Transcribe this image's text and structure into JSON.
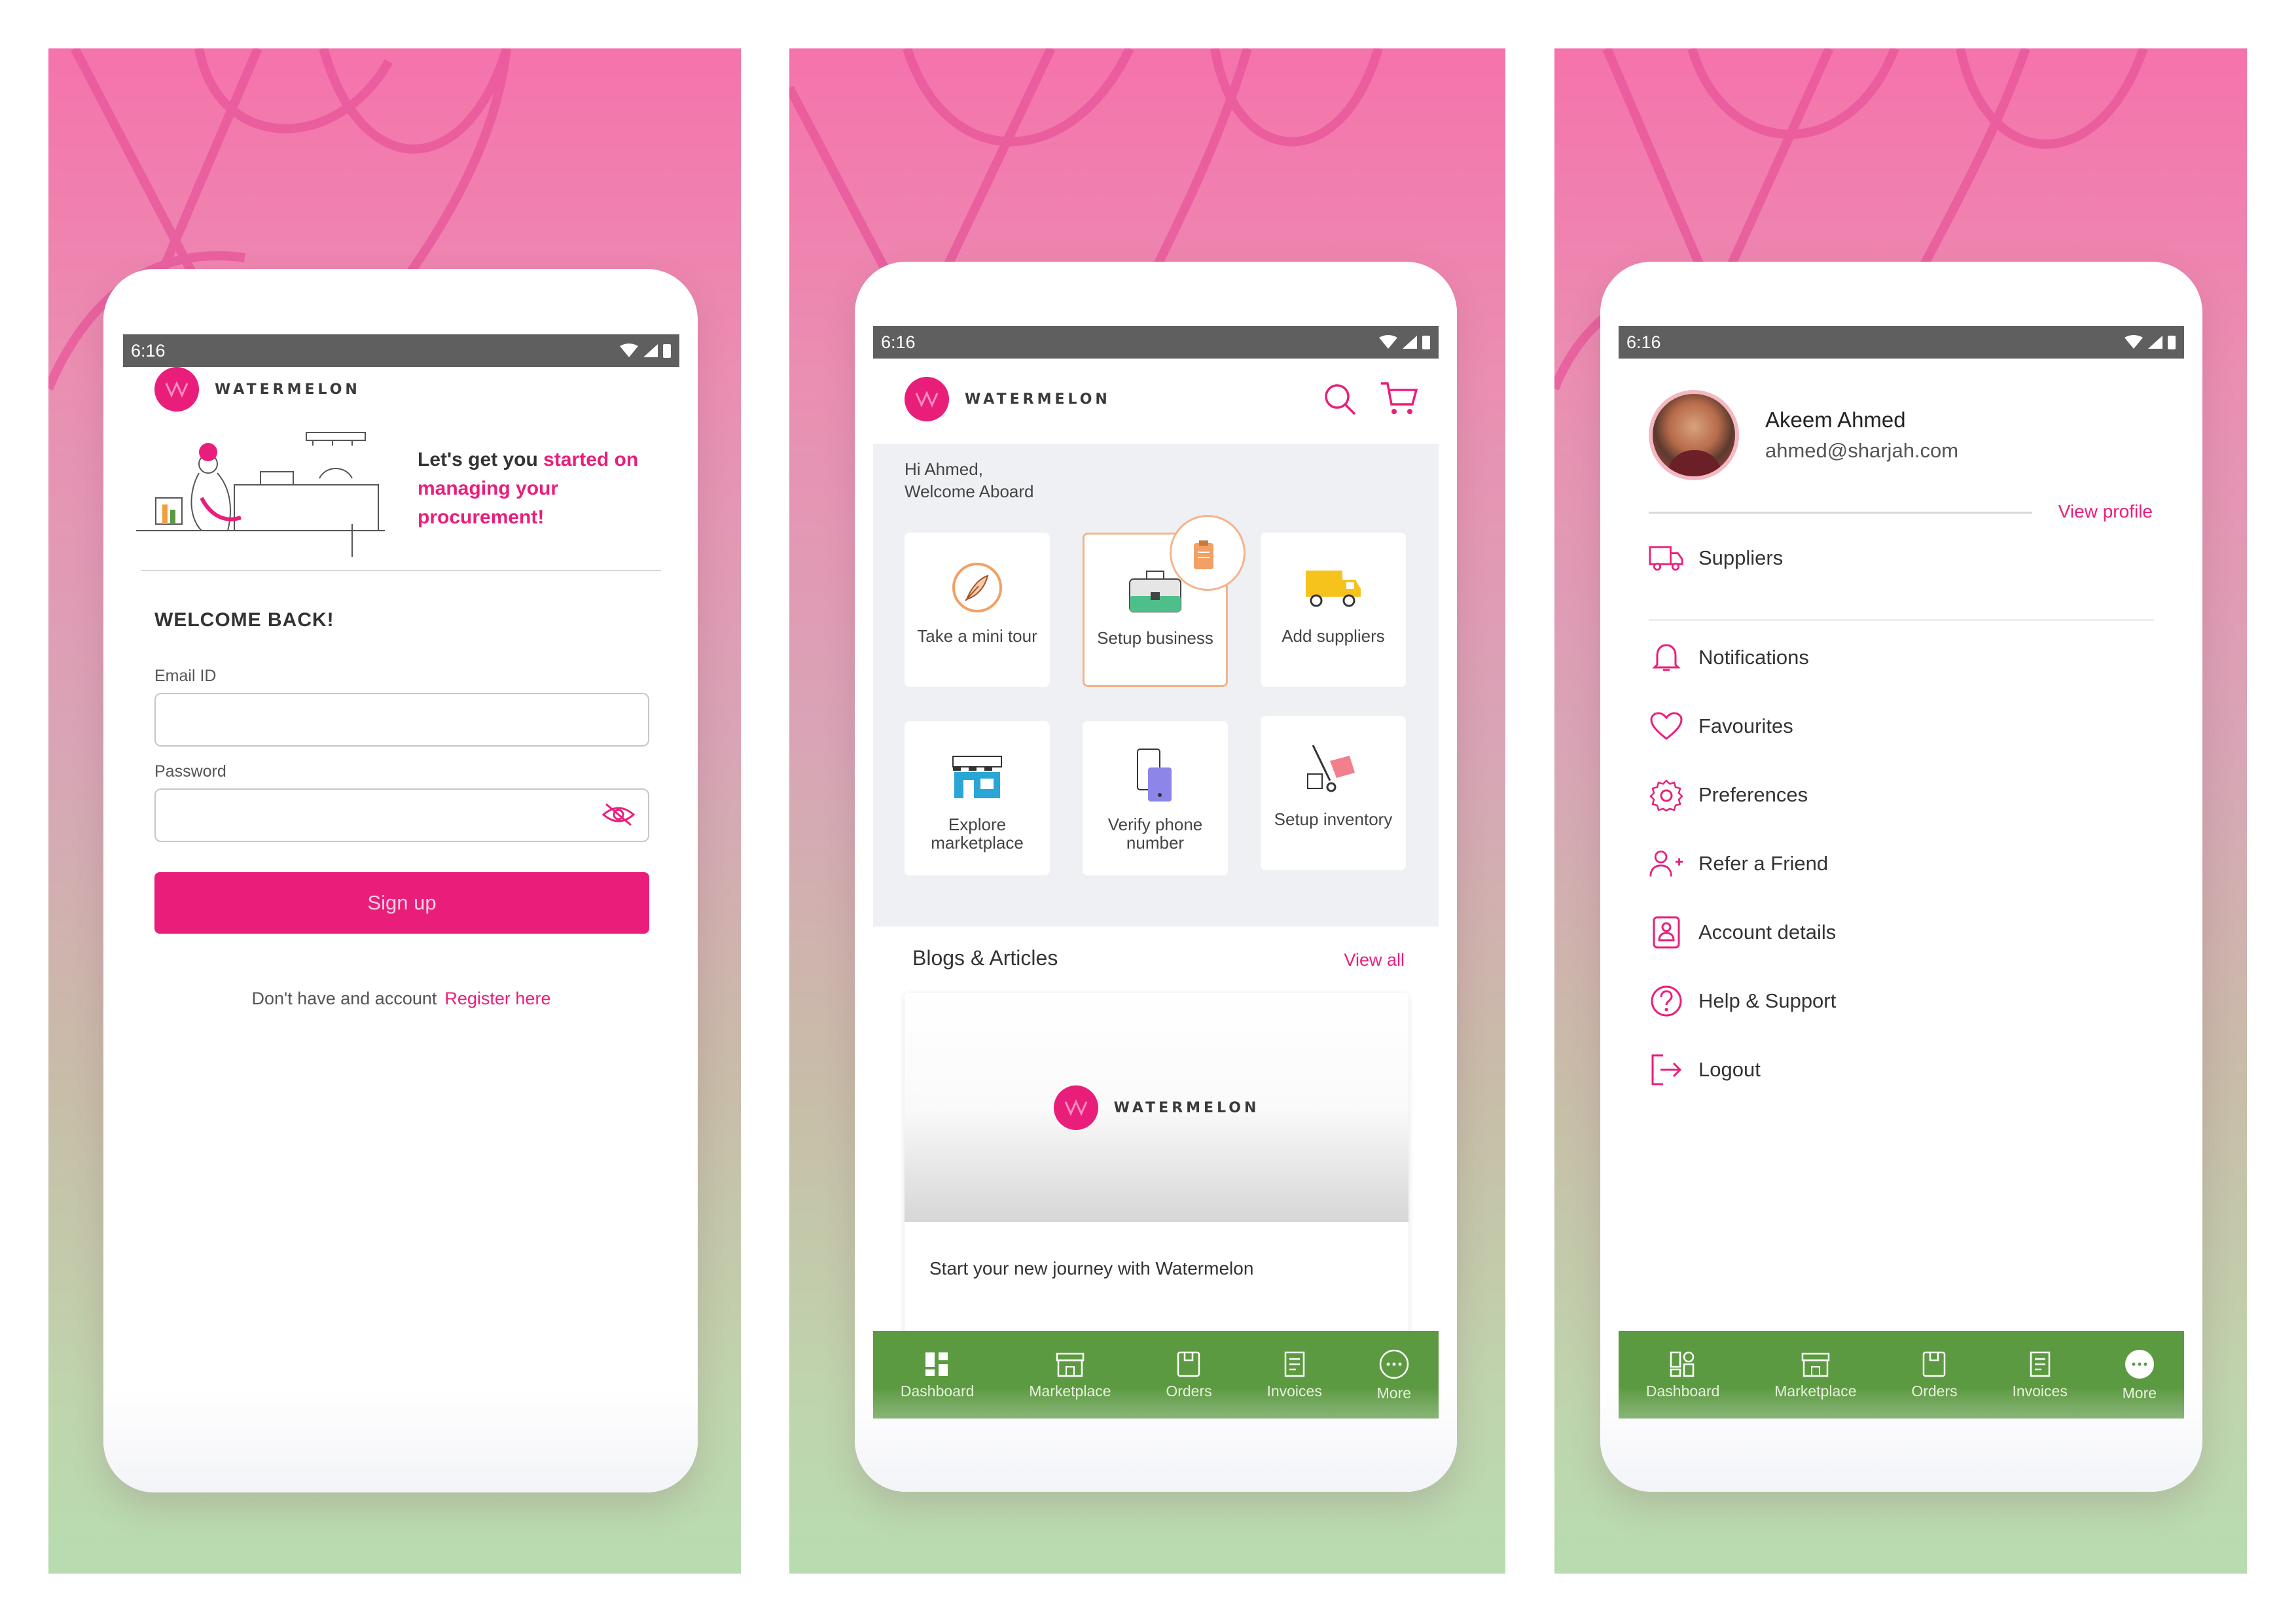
{
  "status": {
    "time": "6:16"
  },
  "brand": {
    "name": "WATERMELON",
    "color": "#e91e7b",
    "nav_color": "#5c9a41"
  },
  "login": {
    "tagline_plain": "Let's get you ",
    "tagline_pink": "started on managing your procurement!",
    "welcome": "WELCOME BACK!",
    "email_label": "Email ID",
    "email_value": "",
    "password_label": "Password",
    "password_value": "",
    "signup_label": "Sign up",
    "register_prompt": "Don't have and account",
    "register_link": "Register here"
  },
  "dashboard": {
    "greeting_line1": "Hi Ahmed,",
    "greeting_line2": "Welcome Aboard",
    "tiles": [
      {
        "label": "Take a mini tour",
        "icon": "feather-icon"
      },
      {
        "label": "Setup business",
        "icon": "briefcase-icon",
        "active": true
      },
      {
        "label": "Add suppliers",
        "icon": "truck-icon"
      },
      {
        "label": "Explore marketplace",
        "icon": "storefront-icon"
      },
      {
        "label": "Verify phone number",
        "icon": "phone-icon"
      },
      {
        "label": "Setup inventory",
        "icon": "hand-truck-icon"
      }
    ],
    "blogs_title": "Blogs & Articles",
    "view_all": "View all",
    "blog_caption": "Start your new journey with Watermelon"
  },
  "nav": [
    {
      "label": "Dashboard",
      "icon": "dashboard-icon"
    },
    {
      "label": "Marketplace",
      "icon": "store-icon"
    },
    {
      "label": "Orders",
      "icon": "orders-icon"
    },
    {
      "label": "Invoices",
      "icon": "invoice-icon"
    },
    {
      "label": "More",
      "icon": "more-icon"
    }
  ],
  "profile": {
    "name": "Akeem Ahmed",
    "email": "ahmed@sharjah.com",
    "view_profile": "View profile",
    "menu": [
      {
        "label": "Suppliers",
        "icon": "truck-icon"
      },
      {
        "label": "Notifications",
        "icon": "bell-icon"
      },
      {
        "label": "Favourites",
        "icon": "heart-icon"
      },
      {
        "label": "Preferences",
        "icon": "gear-icon"
      },
      {
        "label": "Refer a Friend",
        "icon": "add-user-icon"
      },
      {
        "label": "Account details",
        "icon": "id-card-icon"
      },
      {
        "label": "Help & Support",
        "icon": "help-icon"
      },
      {
        "label": "Logout",
        "icon": "logout-icon"
      }
    ]
  }
}
